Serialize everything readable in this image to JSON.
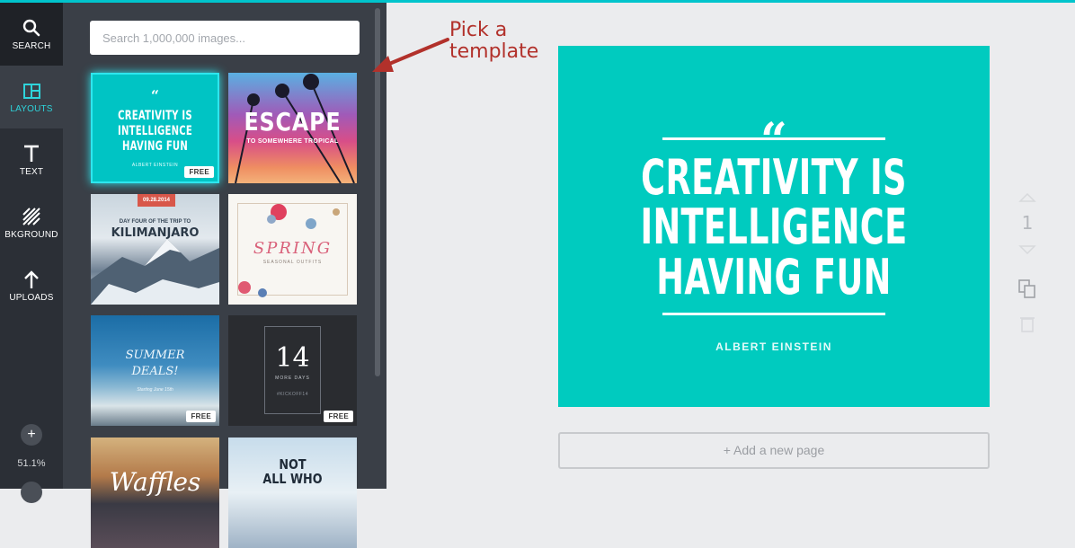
{
  "rail": {
    "search_label": "SEARCH",
    "layouts_label": "LAYOUTS",
    "text_label": "TEXT",
    "background_label": "BKGROUND",
    "uploads_label": "UPLOADS",
    "zoom_plus": "+",
    "zoom_level": "51.1%"
  },
  "panel": {
    "search_placeholder": "Search 1,000,000 images...",
    "templates": [
      {
        "quote_mark": "“",
        "lines": [
          "CREATIVITY IS",
          "INTELLIGENCE",
          "HAVING FUN"
        ],
        "author": "ALBERT EINSTEIN",
        "badge": "FREE"
      },
      {
        "title": "ESCAPE",
        "subtitle": "TO SOMEWHERE TROPICAL"
      },
      {
        "date": "09.28.2014",
        "subtitle": "DAY FOUR OF THE TRIP TO",
        "title": "KILIMANJARO"
      },
      {
        "title": "SPRING",
        "subtitle": "SEASONAL OUTFITS"
      },
      {
        "title_line1": "SUMMER",
        "title_line2": "DEALS!",
        "subtitle": "Starting June 15th",
        "badge": "FREE"
      },
      {
        "number": "14",
        "subtitle": "MORE DAYS",
        "tag": "#KICKOFF14",
        "badge": "FREE"
      },
      {
        "title": "Waffles"
      },
      {
        "title_line1": "NOT",
        "title_line2": "ALL WHO"
      }
    ]
  },
  "annotation": {
    "line1": "Pick a",
    "line2": "template"
  },
  "canvas": {
    "quote_mark": "“",
    "line1": "CREATIVITY IS",
    "line2": "INTELLIGENCE",
    "line3": "HAVING FUN",
    "author": "ALBERT EINSTEIN",
    "background_color": "#00cbbf"
  },
  "page_controls": {
    "page_number": "1"
  },
  "add_page_label": "+ Add a new page",
  "colors": {
    "accent": "#00c4cc",
    "annotation": "#b2312b"
  }
}
